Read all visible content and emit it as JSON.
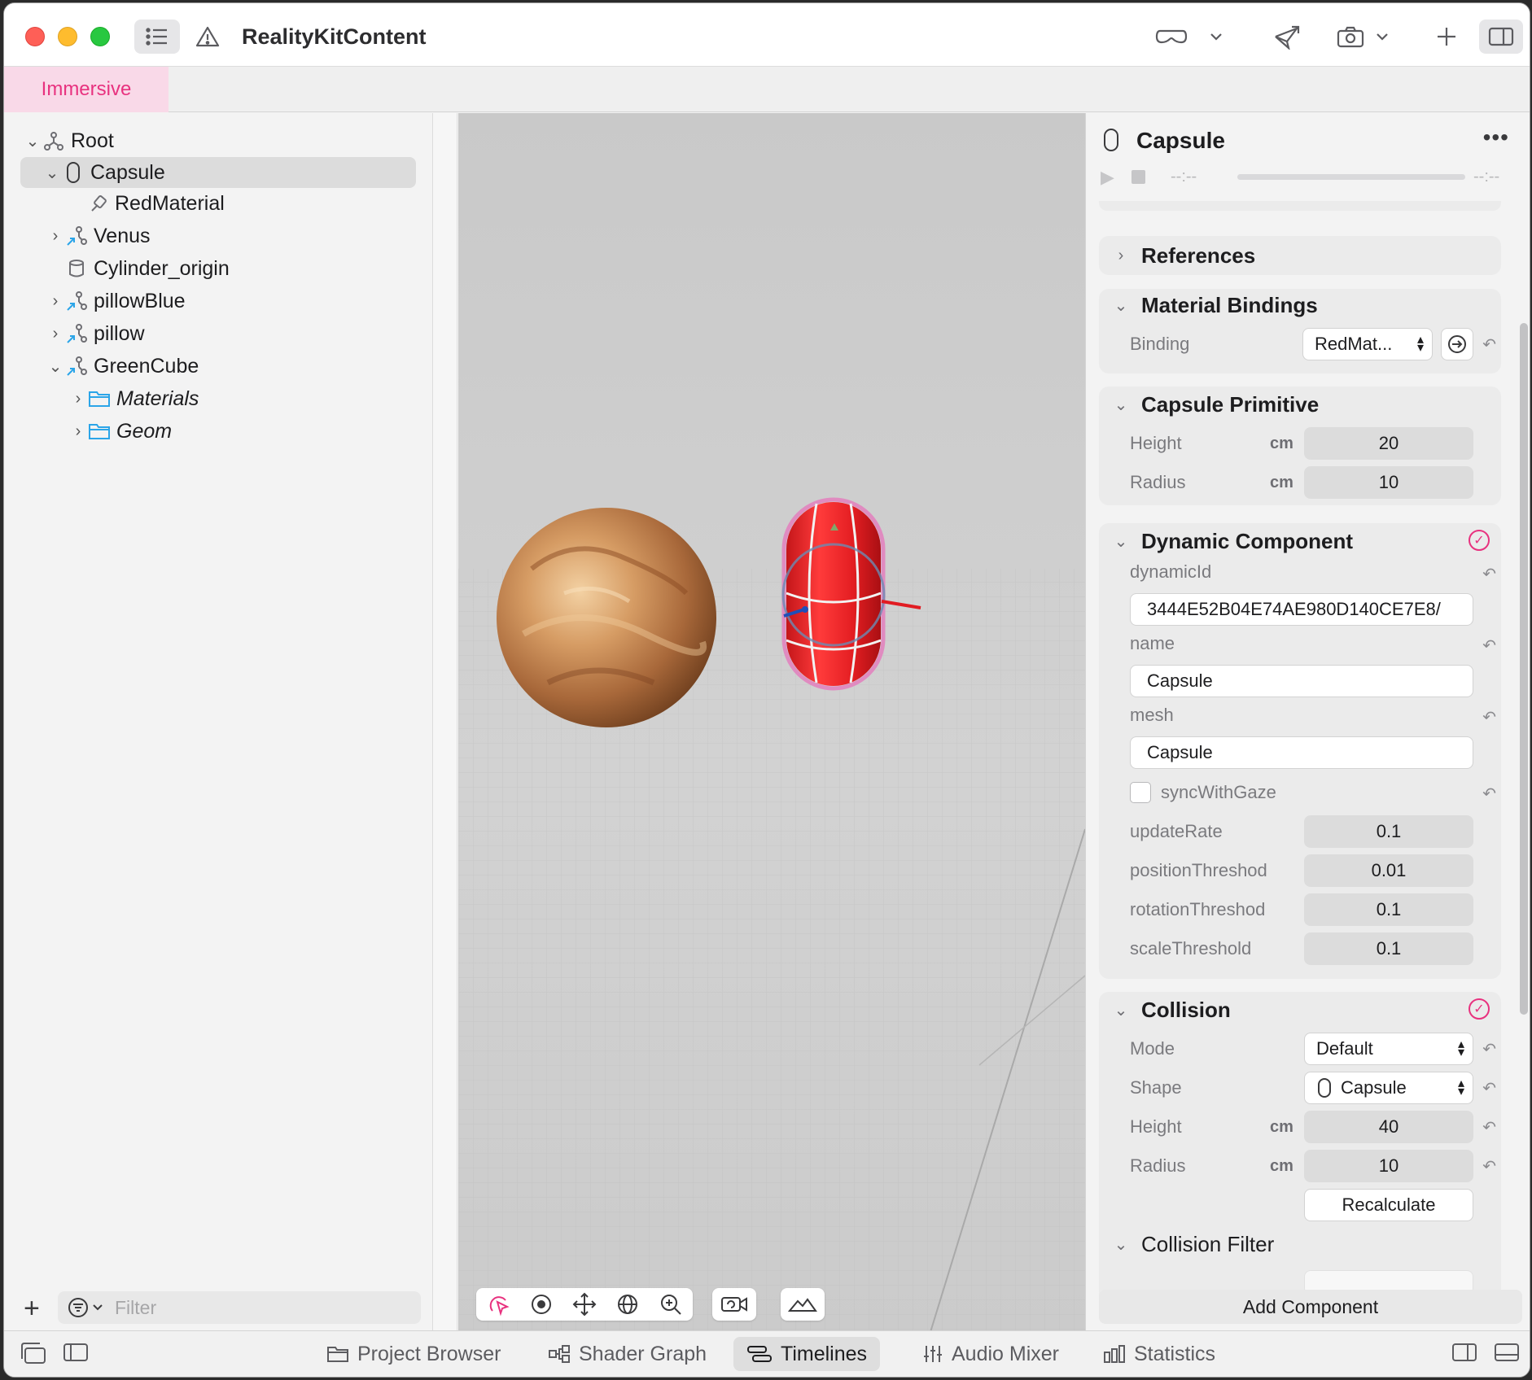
{
  "window": {
    "title": "RealityKitContent",
    "colors": {
      "accent": "#e8327f",
      "tab_bg": "#f9d9e8",
      "close": "#fe5f57",
      "minimize": "#febc2e",
      "zoom": "#28c840"
    }
  },
  "tabs": [
    {
      "label": "Immersive",
      "active": true
    }
  ],
  "scene_tree": [
    {
      "label": "Root",
      "icon": "entity-icon",
      "expanded": true
    },
    {
      "label": "Capsule",
      "icon": "capsule-icon",
      "expanded": true,
      "selected": true
    },
    {
      "label": "RedMaterial",
      "icon": "material-icon"
    },
    {
      "label": "Venus",
      "icon": "reference-entity-icon",
      "expanded": false
    },
    {
      "label": "Cylinder_origin",
      "icon": "cylinder-icon"
    },
    {
      "label": "pillowBlue",
      "icon": "reference-entity-icon",
      "expanded": false
    },
    {
      "label": "pillow",
      "icon": "reference-entity-icon",
      "expanded": false
    },
    {
      "label": "GreenCube",
      "icon": "reference-entity-icon",
      "expanded": true
    },
    {
      "label": "Materials",
      "icon": "folder-icon",
      "expanded": false
    },
    {
      "label": "Geom",
      "icon": "folder-icon",
      "expanded": false
    }
  ],
  "filter": {
    "placeholder": "Filter"
  },
  "inspector": {
    "title": "Capsule",
    "timeline": {
      "start": "--:--",
      "end": "--:--"
    },
    "references": {
      "title": "References"
    },
    "material_bindings": {
      "title": "Material Bindings",
      "binding_label": "Binding",
      "binding_value": "RedMat..."
    },
    "capsule_primitive": {
      "title": "Capsule Primitive",
      "height_label": "Height",
      "height_unit": "cm",
      "height_value": "20",
      "radius_label": "Radius",
      "radius_unit": "cm",
      "radius_value": "10"
    },
    "dynamic_component": {
      "title": "Dynamic Component",
      "dynamicId_label": "dynamicId",
      "dynamicId_value": "3444E52B04E74AE980D140CE7E8/",
      "name_label": "name",
      "name_value": "Capsule",
      "mesh_label": "mesh",
      "mesh_value": "Capsule",
      "syncWithGaze_label": "syncWithGaze",
      "syncWithGaze_checked": false,
      "updateRate_label": "updateRate",
      "updateRate_value": "0.1",
      "positionThreshod_label": "positionThreshod",
      "positionThreshod_value": "0.01",
      "rotationThreshod_label": "rotationThreshod",
      "rotationThreshod_value": "0.1",
      "scaleThreshold_label": "scaleThreshold",
      "scaleThreshold_value": "0.1"
    },
    "collision": {
      "title": "Collision",
      "mode_label": "Mode",
      "mode_value": "Default",
      "shape_label": "Shape",
      "shape_value": "Capsule",
      "height_label": "Height",
      "height_unit": "cm",
      "height_value": "40",
      "radius_label": "Radius",
      "radius_unit": "cm",
      "radius_value": "10",
      "recalculate_label": "Recalculate"
    },
    "collision_filter": {
      "title": "Collision Filter"
    },
    "add_component_label": "Add Component"
  },
  "bottom_tabs": [
    {
      "label": "Project Browser",
      "icon": "folder-icon"
    },
    {
      "label": "Shader Graph",
      "icon": "shader-graph-icon"
    },
    {
      "label": "Timelines",
      "icon": "timelines-icon",
      "active": true
    },
    {
      "label": "Audio Mixer",
      "icon": "audio-mixer-icon"
    },
    {
      "label": "Statistics",
      "icon": "statistics-icon"
    }
  ]
}
